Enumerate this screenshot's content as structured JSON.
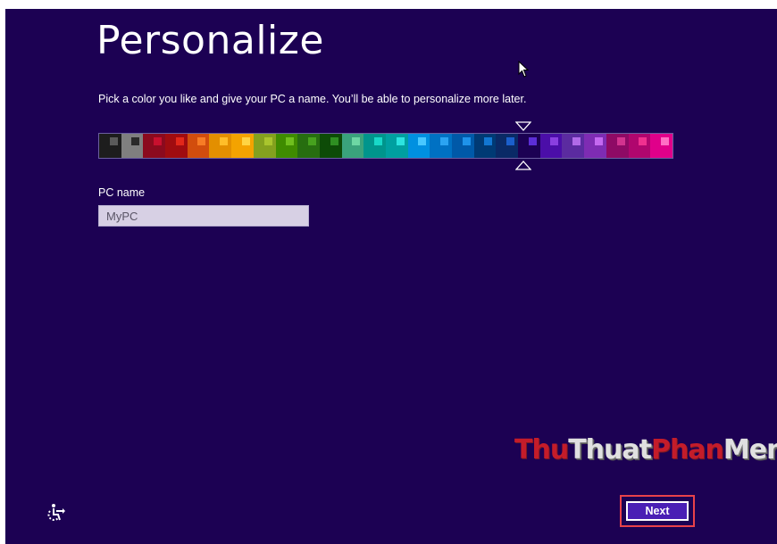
{
  "page": {
    "title": "Personalize",
    "subtitle": "Pick a color you like and give your PC a name. You’ll be able to personalize more later.",
    "pc_name_label": "PC name",
    "pc_name_value": "MyPC",
    "next_label": "Next",
    "watermark_red": "Thu",
    "watermark_mid": "Thuat",
    "watermark_red2": "Phan",
    "watermark_end": "Mem.vn"
  },
  "colors": {
    "background": "#1c0153",
    "selected_swatch_index": 19
  },
  "palette": [
    {
      "bg": "#1d1d1d",
      "chip": "#5a5a5a"
    },
    {
      "bg": "#7f7f7f",
      "chip": "#2a2a2a"
    },
    {
      "bg": "#8b0a1e",
      "chip": "#c8102e"
    },
    {
      "bg": "#a00c10",
      "chip": "#e2281a"
    },
    {
      "bg": "#d24d0d",
      "chip": "#f77c25"
    },
    {
      "bg": "#e38f00",
      "chip": "#ffbe29"
    },
    {
      "bg": "#f4a300",
      "chip": "#ffd443"
    },
    {
      "bg": "#84a11e",
      "chip": "#a9c52d"
    },
    {
      "bg": "#3f8c00",
      "chip": "#6fbf1e"
    },
    {
      "bg": "#276e10",
      "chip": "#47a11e"
    },
    {
      "bg": "#0d4b07",
      "chip": "#2f8f22"
    },
    {
      "bg": "#3aa37c",
      "chip": "#6ed7a4"
    },
    {
      "bg": "#00958c",
      "chip": "#18d8c8"
    },
    {
      "bg": "#00a0a0",
      "chip": "#2ce4e0"
    },
    {
      "bg": "#0090e0",
      "chip": "#48c8ff"
    },
    {
      "bg": "#0071c3",
      "chip": "#2ba4f2"
    },
    {
      "bg": "#0059a8",
      "chip": "#1e93ea"
    },
    {
      "bg": "#003a74",
      "chip": "#1277d2"
    },
    {
      "bg": "#0a2a66",
      "chip": "#1b5fcc"
    },
    {
      "bg": "#1c0153",
      "chip": "#5c2ed6"
    },
    {
      "bg": "#4b0ea8",
      "chip": "#8a3fe0"
    },
    {
      "bg": "#5b2ba0",
      "chip": "#b06ae8"
    },
    {
      "bg": "#7e2cb3",
      "chip": "#c468f0"
    },
    {
      "bg": "#8e0a65",
      "chip": "#d2338f"
    },
    {
      "bg": "#b0066e",
      "chip": "#f0308f"
    },
    {
      "bg": "#e0008a",
      "chip": "#ff6fc4"
    }
  ],
  "icons": {
    "cursor": "mouse-pointer-icon",
    "ease_of_access": "ease-of-access-icon",
    "selector_top": "chevron-down-icon",
    "selector_bottom": "chevron-up-icon"
  }
}
